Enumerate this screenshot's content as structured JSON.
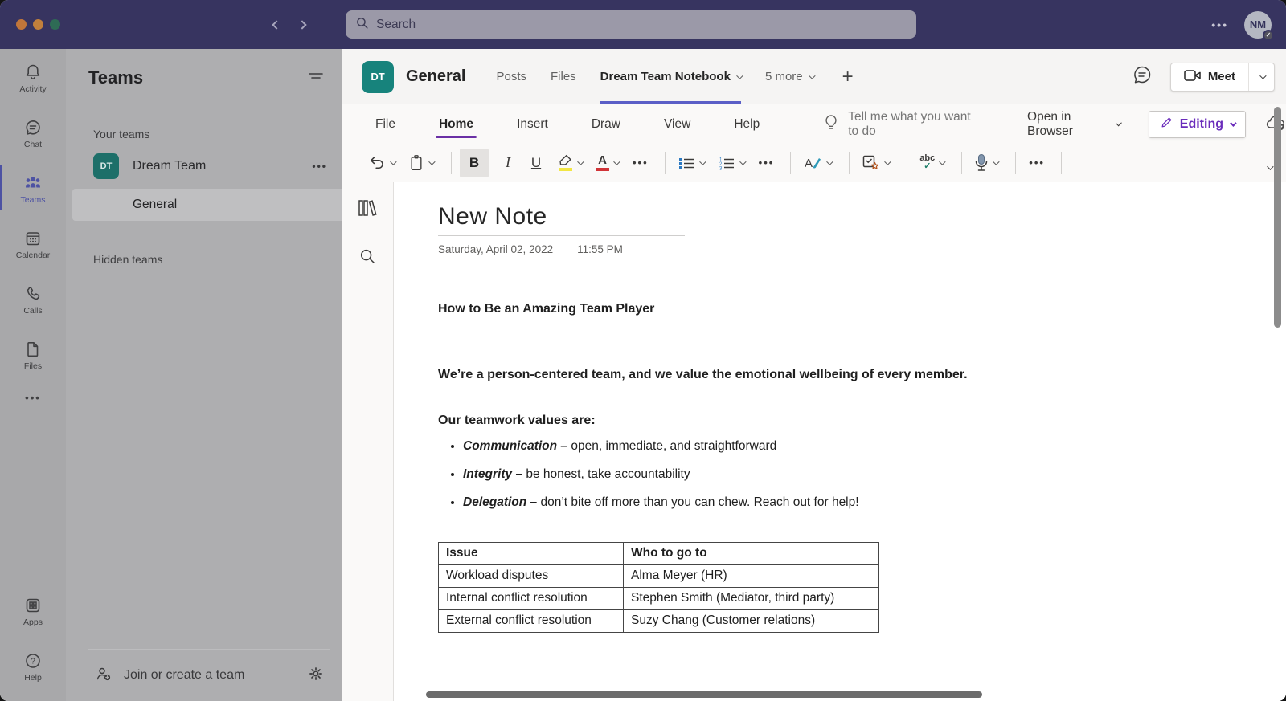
{
  "topbar": {
    "search_placeholder": "Search",
    "more_glyph": "•••",
    "avatar_initials": "NM"
  },
  "rail": {
    "items": [
      {
        "label": "Activity"
      },
      {
        "label": "Chat"
      },
      {
        "label": "Teams"
      },
      {
        "label": "Calendar"
      },
      {
        "label": "Calls"
      },
      {
        "label": "Files"
      }
    ],
    "more_glyph": "•••",
    "bottom_items": [
      {
        "label": "Apps"
      },
      {
        "label": "Help"
      }
    ]
  },
  "teams_panel": {
    "title": "Teams",
    "your_teams_label": "Your teams",
    "team": {
      "initials": "DT",
      "name": "Dream Team"
    },
    "team_more_glyph": "•••",
    "active_channel": "General",
    "hidden_teams_label": "Hidden teams",
    "join_label": "Join or create a team"
  },
  "channel_header": {
    "team_initials": "DT",
    "title": "General",
    "tabs": [
      {
        "label": "Posts"
      },
      {
        "label": "Files"
      },
      {
        "label": "Dream Team Notebook"
      },
      {
        "label": "5 more"
      }
    ],
    "add_tab_glyph": "+",
    "meet_label": "Meet"
  },
  "ribbon": {
    "menus": [
      {
        "label": "File"
      },
      {
        "label": "Home"
      },
      {
        "label": "Insert"
      },
      {
        "label": "Draw"
      },
      {
        "label": "View"
      },
      {
        "label": "Help"
      }
    ],
    "active_menu": "Home",
    "tell_me_placeholder": "Tell me what you want to do",
    "open_in_browser_label": "Open in Browser",
    "editing_label": "Editing"
  },
  "toolbar": {
    "bold_glyph": "B",
    "italic_glyph": "I",
    "underline_glyph": "U",
    "spellcheck_glyph": "abc",
    "more_glyph": "•••"
  },
  "note": {
    "title": "New Note",
    "date": "Saturday, April 02, 2022",
    "time": "11:55 PM",
    "heading": "How to Be an Amazing Team Player",
    "intro": "We’re a person-centered team, and we value the emotional wellbeing of every member.",
    "values_label": "Our teamwork values are:",
    "bullets": [
      {
        "term": "Communication –",
        "text": " open, immediate, and straightforward"
      },
      {
        "term": "Integrity –",
        "text": " be honest, take accountability"
      },
      {
        "term": "Delegation –",
        "text": " don’t bite off more than you can chew. Reach out for help!"
      }
    ],
    "table": {
      "headers": [
        "Issue",
        "Who to go to"
      ],
      "rows": [
        [
          "Workload disputes",
          "Alma Meyer (HR)"
        ],
        [
          "Internal conflict resolution",
          "Stephen Smith (Mediator, third party)"
        ],
        [
          "External conflict resolution",
          "Suzy Chang (Customer relations)"
        ]
      ]
    }
  },
  "colors": {
    "topbar_background": "#373460",
    "teams_accent": "#5b5fc7",
    "onenote_accent": "#6a30a5",
    "team_avatar_teal": "#17837c",
    "highlight_yellow": "#f2e643",
    "font_color_red": "#d13438"
  }
}
